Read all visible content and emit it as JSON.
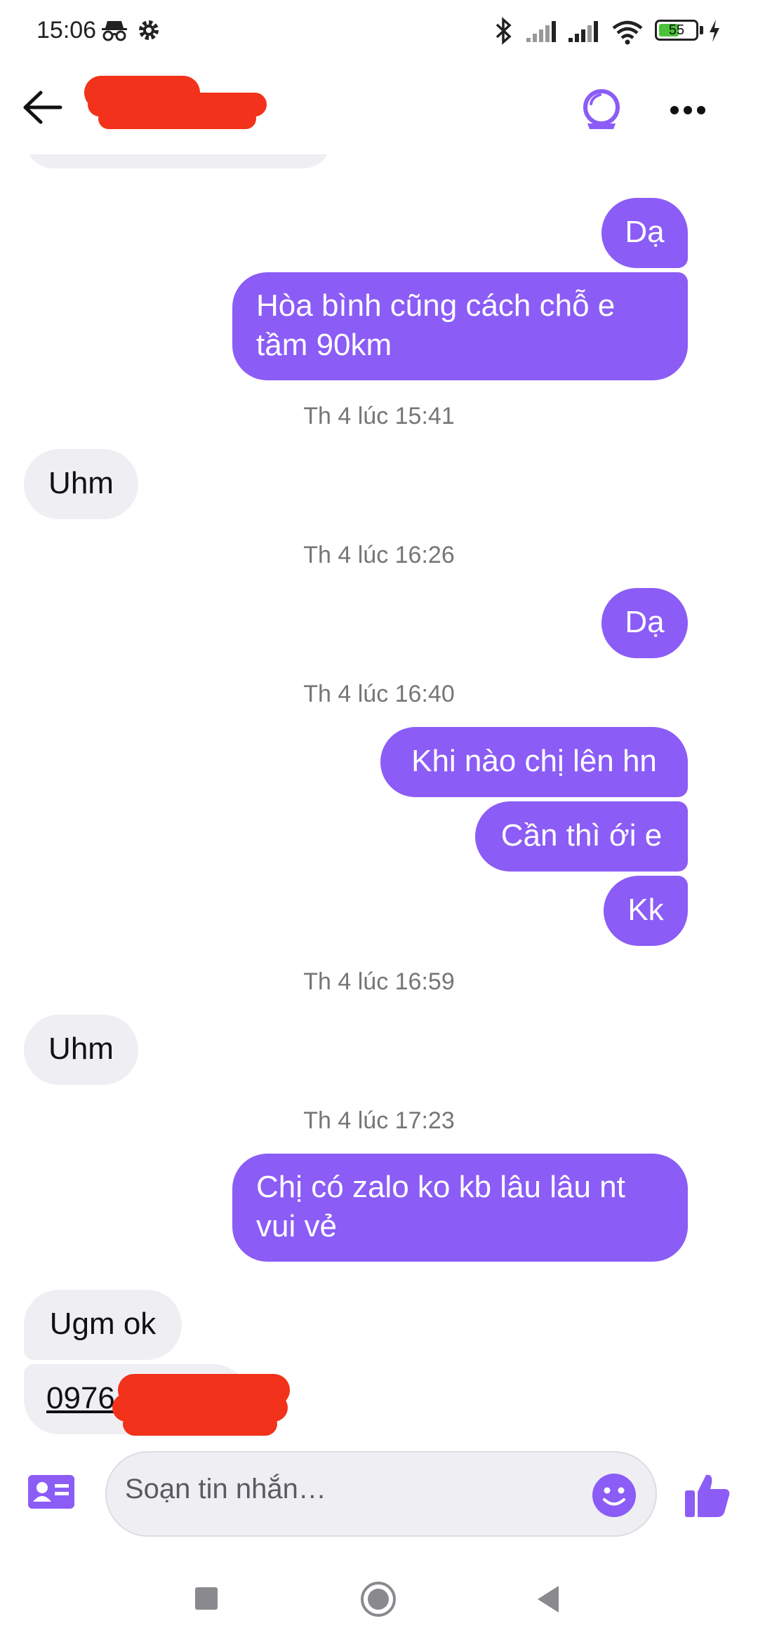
{
  "status_bar": {
    "time": "15:06",
    "battery": "55",
    "battery_level": 0.55,
    "icons": [
      "incognito-icon",
      "settings-gear-icon",
      "bluetooth-icon",
      "signal-icon",
      "signal-icon",
      "wifi-icon",
      "battery-icon",
      "charging-bolt-icon"
    ]
  },
  "header": {
    "icons": [
      "back-arrow-icon",
      "wristwatch-icon",
      "more-options-icon"
    ]
  },
  "messages": [
    {
      "type": "out",
      "text": "Dạ"
    },
    {
      "type": "out",
      "text": "Hòa bình cũng cách chỗ e tầm 90km"
    },
    {
      "type": "timestamp",
      "text": "Th 4 lúc 15:41"
    },
    {
      "type": "in",
      "text": "Uhm"
    },
    {
      "type": "timestamp",
      "text": "Th 4 lúc 16:26"
    },
    {
      "type": "out",
      "text": "Dạ"
    },
    {
      "type": "timestamp",
      "text": "Th 4 lúc 16:40"
    },
    {
      "type": "out",
      "text": "Khi nào chị lên hn"
    },
    {
      "type": "out",
      "text": "Cần thì ới e"
    },
    {
      "type": "out",
      "text": "Kk"
    },
    {
      "type": "timestamp",
      "text": "Th 4 lúc 16:59"
    },
    {
      "type": "in",
      "text": "Uhm"
    },
    {
      "type": "timestamp",
      "text": "Th 4 lúc 17:23"
    },
    {
      "type": "out",
      "text": "Chị có zalo ko kb lâu lâu nt vui vẻ"
    },
    {
      "type": "in",
      "text": "Ugm ok"
    },
    {
      "type": "in",
      "text": "0976"
    }
  ],
  "composer": {
    "placeholder": "Soạn tin nhắn…",
    "icons": [
      "contact-card-icon",
      "emoji-icon",
      "thumbs-up-icon"
    ]
  },
  "nav_bar": {
    "icons": [
      "recents-square-icon",
      "home-circle-icon",
      "back-triangle-icon"
    ]
  },
  "colors": {
    "accent": "#8b5cf6",
    "incoming_bubble": "#efeff3",
    "redaction": "#f2321a"
  }
}
